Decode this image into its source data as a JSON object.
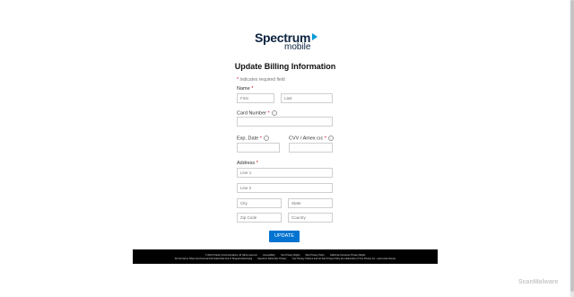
{
  "logo": {
    "brand": "Spectrum",
    "sub": "mobile"
  },
  "page_title": "Update Billing Information",
  "required_note": {
    "star": "*",
    "text": " Indicates required field"
  },
  "name": {
    "label": "Name",
    "star": "*",
    "first_placeholder": "First",
    "last_placeholder": "Last"
  },
  "card": {
    "label": "Card Number",
    "star": "*",
    "info": "i"
  },
  "exp": {
    "label": "Exp. Date",
    "star": "*",
    "info": "i"
  },
  "cvv": {
    "label": "CVV / Amex cıc",
    "star": "*",
    "info": "i"
  },
  "address": {
    "label": "Address",
    "star": "*",
    "line1_placeholder": "Line 1",
    "line2_placeholder": "Line 2",
    "city_placeholder": "City",
    "state_placeholder": "State",
    "zip_placeholder": "Zip Code",
    "country_placeholder": "Country"
  },
  "update_button": "UPDATE",
  "footer": {
    "row1": [
      "© 2024 Charter Communications. All rights reserved.",
      "Accessibility",
      "Your Privacy Rights",
      "Web Privacy Policy",
      "California Consumer Privacy Rights"
    ],
    "row2": [
      "Do Not Sell or Share My Personal Information/Opt-Out of Targeted Advertising",
      "Spectrum Subscriber Privacy",
      "Your Privacy Choices and Go Site Privacy Policy are trademarks of Your Privacy Inc., used under license"
    ]
  },
  "watermark": "ScanMalware"
}
